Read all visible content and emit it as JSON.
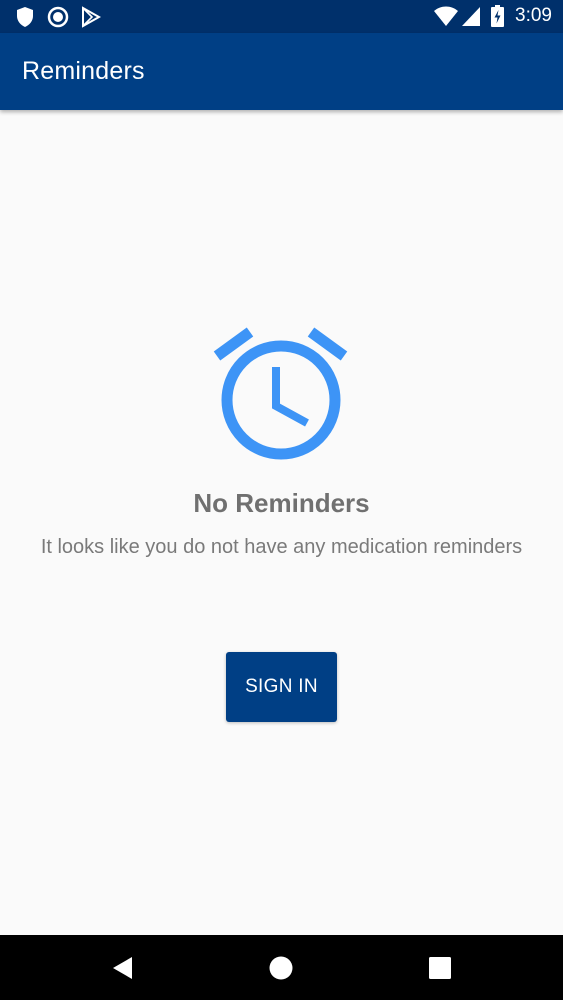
{
  "status_bar": {
    "time": "3:09",
    "icons": [
      "shield-icon",
      "circle-record-icon",
      "play-store-icon",
      "wifi-icon",
      "cell-signal-icon",
      "battery-charging-icon"
    ]
  },
  "app_bar": {
    "title": "Reminders"
  },
  "empty_state": {
    "icon": "alarm-clock-icon",
    "title": "No Reminders",
    "message": "It looks like you do not have any medication reminders"
  },
  "actions": {
    "sign_in_label": "SIGN IN"
  },
  "nav_bar": {
    "icons": [
      "back-icon",
      "home-icon",
      "recents-icon"
    ]
  },
  "colors": {
    "status_bar": "#00306b",
    "app_bar": "#003f85",
    "accent_icon": "#3d94f6",
    "background": "#fafafa",
    "text_muted": "#707070"
  }
}
